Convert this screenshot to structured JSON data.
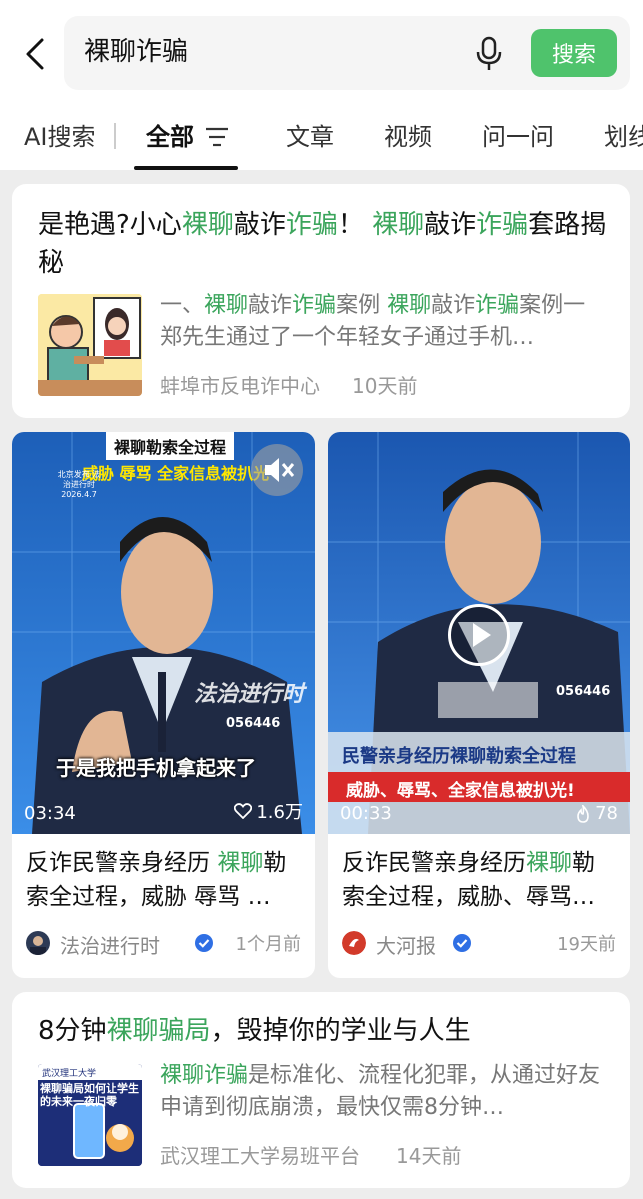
{
  "search": {
    "query": "裸聊诈骗",
    "button": "搜索"
  },
  "tabs": [
    "AI搜索",
    "全部",
    "文章",
    "视频",
    "问一问",
    "划线"
  ],
  "result1": {
    "title": [
      {
        "t": "是艳遇?小心"
      },
      {
        "t": "裸聊",
        "h": true
      },
      {
        "t": "敲诈"
      },
      {
        "t": "诈骗",
        "h": true
      },
      {
        "t": "！ "
      },
      {
        "t": "裸聊",
        "h": true
      },
      {
        "t": "敲诈"
      },
      {
        "t": "诈骗",
        "h": true
      },
      {
        "t": "套路揭秘"
      }
    ],
    "snippet": [
      {
        "t": "一、"
      },
      {
        "t": "裸聊",
        "h": true
      },
      {
        "t": "敲诈"
      },
      {
        "t": "诈骗",
        "h": true
      },
      {
        "t": "案例 "
      },
      {
        "t": "裸聊",
        "h": true
      },
      {
        "t": "敲诈"
      },
      {
        "t": "诈骗",
        "h": true
      },
      {
        "t": "案例一 郑先生通过了一个年轻女子通过手机…"
      }
    ],
    "source": "蚌埠市反电诈中心",
    "time": "10天前"
  },
  "video1": {
    "banner": "裸聊勒索全过程",
    "banner2": "威胁 辱骂 全家信息被扒光",
    "corner": "北京发布 法治进行时 2026.4.7",
    "overlay": "法治进行时",
    "badge": "056446",
    "subtitle": "于是我把手机拿起来了",
    "duration": "03:34",
    "likes": "1.6万",
    "title": [
      {
        "t": "反诈民警亲身经历 "
      },
      {
        "t": "裸聊",
        "h": true
      },
      {
        "t": "勒索全过程，威胁 辱骂 …"
      }
    ],
    "source": "法治进行时",
    "time": "1个月前"
  },
  "video2": {
    "badge": "056446",
    "caption1": "民警亲身经历裸聊勒索全过程",
    "caption2": "威胁、辱骂、全家信息被扒光!",
    "duration": "00:33",
    "likes": "78",
    "title": [
      {
        "t": "反诈民警亲身经历"
      },
      {
        "t": "裸聊",
        "h": true
      },
      {
        "t": "勒索全过程，威胁、辱骂…"
      }
    ],
    "source": "大河报",
    "time": "19天前"
  },
  "result2": {
    "title": [
      {
        "t": "8分钟"
      },
      {
        "t": "裸聊骗局",
        "h": true
      },
      {
        "t": "，毁掉你的学业与人生"
      }
    ],
    "thumb_text": "裸聊骗局如何让学生的未来一夜归零",
    "thumb_header": "武汉理工大学",
    "snippet": [
      {
        "t": "裸聊诈骗",
        "h": true
      },
      {
        "t": "是标准化、流程化犯罪，从通过好友申请到彻底崩溃，最快仅需8分钟…"
      }
    ],
    "source": "武汉理工大学易班平台",
    "time": "14天前"
  },
  "colors": {
    "accent": "#4fc36c",
    "highlight": "#3ba55c"
  }
}
